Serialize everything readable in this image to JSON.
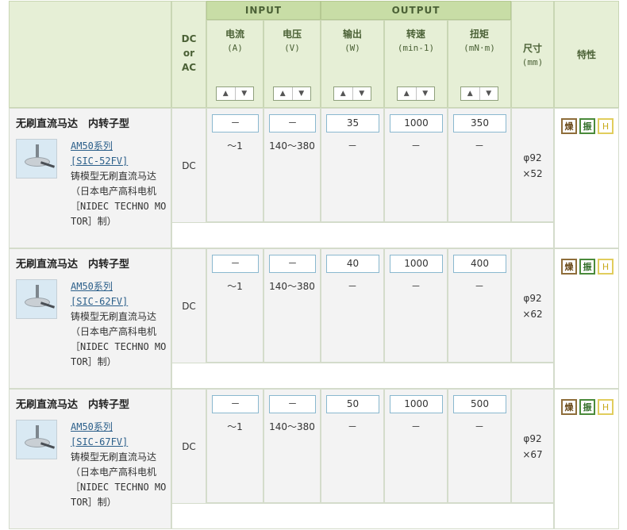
{
  "header": {
    "dc_ac": [
      "DC",
      "or",
      "AC"
    ],
    "input_group": "INPUT",
    "output_group": "OUTPUT",
    "size": {
      "label": "尺寸",
      "unit": "(mm)"
    },
    "features": "特性",
    "columns": [
      {
        "label": "电流",
        "unit": "(A)"
      },
      {
        "label": "电压",
        "unit": "(V)"
      },
      {
        "label": "输出",
        "unit": "(W)"
      },
      {
        "label": "转速",
        "unit": "(min-1)"
      },
      {
        "label": "扭矩",
        "unit": "(mN·m)"
      }
    ],
    "sort_icons": {
      "up": "▲",
      "down": "▼"
    }
  },
  "products": [
    {
      "title": "无刷直流马达　内转子型",
      "series_link": "AM50系列",
      "model_link": "[SIC-52FV]",
      "description": "铸模型无刷直流马达（日本电产高科电机［NIDEC TECHNO MOTOR］制）",
      "dc_ac": "DC",
      "fields": [
        "－",
        "－",
        "35",
        "1000",
        "350"
      ],
      "values": [
        "～1",
        "140～380",
        "－",
        "－",
        "－"
      ],
      "size": [
        "φ92",
        "×52"
      ],
      "badges": [
        "燥",
        "振",
        "H"
      ]
    },
    {
      "title": "无刷直流马达　内转子型",
      "series_link": "AM50系列",
      "model_link": "[SIC-62FV]",
      "description": "铸模型无刷直流马达（日本电产高科电机［NIDEC TECHNO MOTOR］制）",
      "dc_ac": "DC",
      "fields": [
        "－",
        "－",
        "40",
        "1000",
        "400"
      ],
      "values": [
        "～1",
        "140～380",
        "－",
        "－",
        "－"
      ],
      "size": [
        "φ92",
        "×62"
      ],
      "badges": [
        "燥",
        "振",
        "H"
      ]
    },
    {
      "title": "无刷直流马达　内转子型",
      "series_link": "AM50系列",
      "model_link": "[SIC-67FV]",
      "description": "铸模型无刷直流马达（日本电产高科电机［NIDEC TECHNO MOTOR］制）",
      "dc_ac": "DC",
      "fields": [
        "－",
        "－",
        "50",
        "1000",
        "500"
      ],
      "values": [
        "～1",
        "140～380",
        "－",
        "－",
        "－"
      ],
      "size": [
        "φ92",
        "×67"
      ],
      "badges": [
        "燥",
        "振",
        "H"
      ]
    }
  ]
}
